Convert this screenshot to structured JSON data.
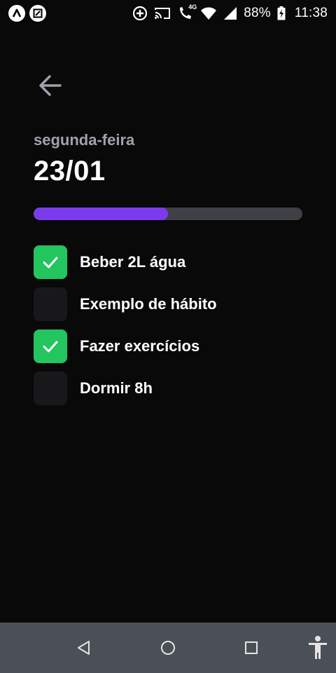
{
  "status_bar": {
    "battery": "88%",
    "time": "11:38",
    "network_label": "4G",
    "icons": [
      "app-a-icon",
      "app-square-icon",
      "add-circle-icon",
      "cast-icon",
      "wifi-call-icon",
      "wifi-icon",
      "signal-icon",
      "battery-charging-icon"
    ]
  },
  "header": {
    "back_icon": "arrow-left-icon",
    "weekday": "segunda-feira",
    "date": "23/01"
  },
  "progress": {
    "completed_fraction": 0.5,
    "fill_color": "#7c3aed",
    "track_color": "#3f3f46"
  },
  "habits": [
    {
      "label": "Beber 2L água",
      "checked": true
    },
    {
      "label": "Exemplo de hábito",
      "checked": false
    },
    {
      "label": "Fazer exercícios",
      "checked": true
    },
    {
      "label": "Dormir 8h",
      "checked": false
    }
  ],
  "colors": {
    "background": "#09090a",
    "checked": "#22c55e",
    "unchecked": "#18181b"
  },
  "nav_bar": {
    "buttons": [
      "back-triangle-icon",
      "home-circle-icon",
      "recents-square-icon",
      "accessibility-icon"
    ]
  }
}
